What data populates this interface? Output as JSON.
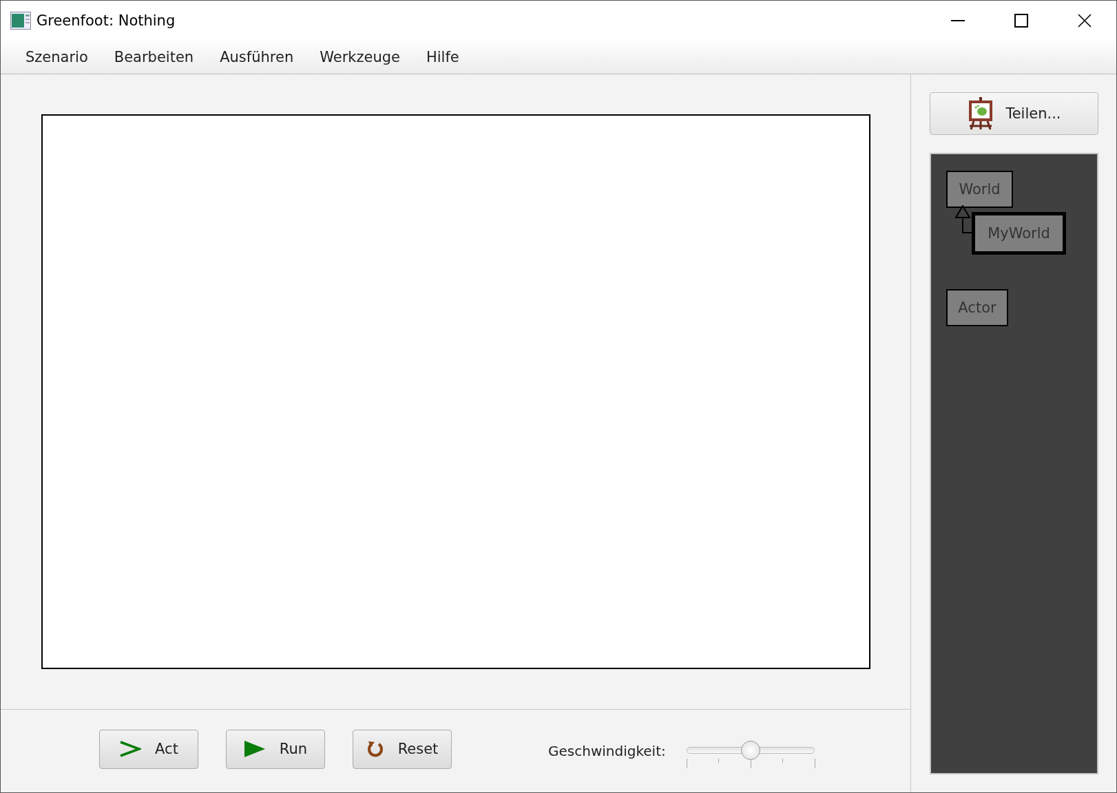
{
  "window": {
    "title": "Greenfoot: Nothing"
  },
  "menu": [
    "Szenario",
    "Bearbeiten",
    "Ausführen",
    "Werkzeuge",
    "Hilfe"
  ],
  "share_button": {
    "label": "Teilen..."
  },
  "class_diagram": {
    "world_classes": [
      {
        "name": "World",
        "selected": false,
        "children": [
          {
            "name": "MyWorld",
            "selected": true
          }
        ]
      }
    ],
    "actor_classes": [
      {
        "name": "Actor",
        "selected": false
      }
    ]
  },
  "controls": [
    {
      "kind": "act",
      "label": "Act"
    },
    {
      "kind": "run",
      "label": "Run"
    },
    {
      "kind": "reset",
      "label": "Reset"
    }
  ],
  "speed": {
    "label": "Geschwindigkeit:",
    "level": 0.5
  }
}
